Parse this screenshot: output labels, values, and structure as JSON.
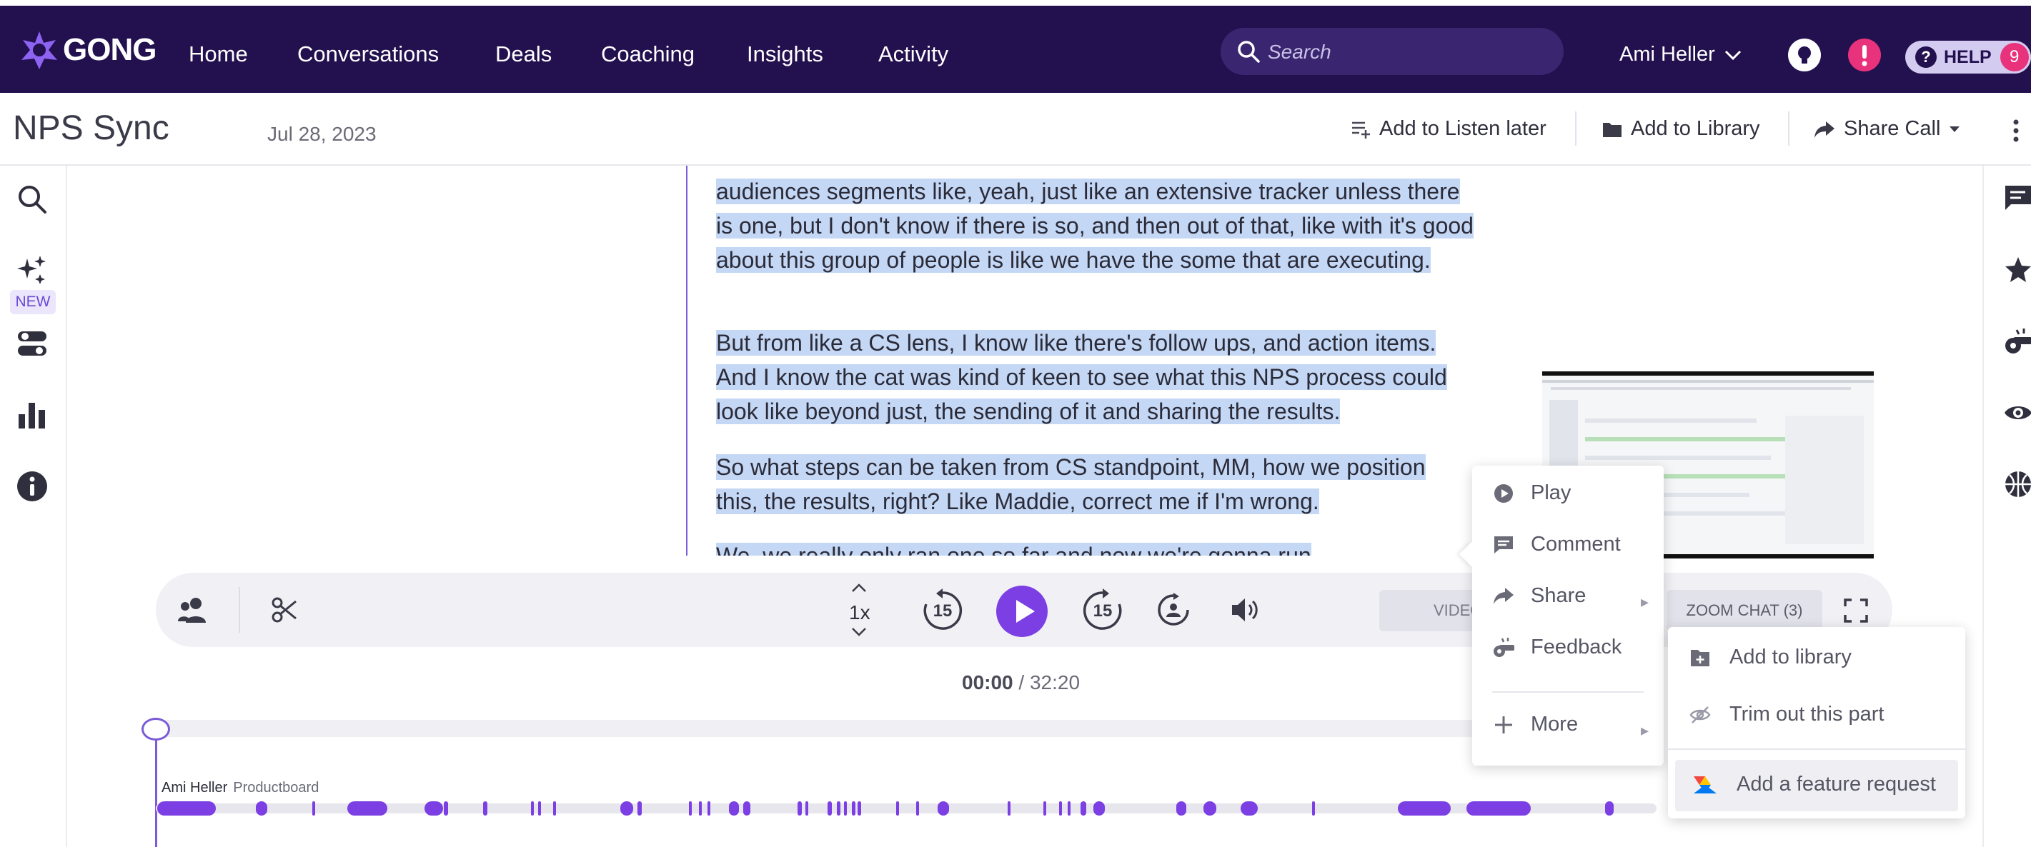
{
  "brand": {
    "logo_text": "GONG",
    "accent": "#7b3fe4",
    "nav_bg": "#23104f"
  },
  "nav": {
    "items": [
      "Home",
      "Conversations",
      "Deals",
      "Coaching",
      "Insights",
      "Activity"
    ],
    "search_placeholder": "Search",
    "user_name": "Ami Heller",
    "help_label": "HELP",
    "help_count": "9"
  },
  "call": {
    "title": "NPS Sync",
    "date": "Jul 28, 2023",
    "actions": {
      "listen_later": "Add to Listen later",
      "library": "Add to Library",
      "share": "Share Call"
    }
  },
  "left_rail": {
    "new_badge": "NEW"
  },
  "transcript": {
    "paragraphs": [
      "audiences segments like, yeah, just like an extensive tracker unless there is one, but I don't know if there is so, and then out of that, like with it's good about this group of people is like we have the some that are executing.",
      "But from like a CS lens, I know like there's follow ups, and action items. And I know the cat was kind of keen to see what this NPS process could look like beyond just, the sending of it and sharing the results.",
      "So what steps can be taken from CS standpoint, MM, how we position this, the results, right? Like Maddie, correct me if I'm wrong.",
      "We, we really only ran one so far and now we're gonna run"
    ]
  },
  "player": {
    "speed": "1x",
    "skip_back": "15",
    "skip_forward": "15",
    "video_tab": "VIDEO",
    "zoom_tab": "ZOOM CHAT (3)",
    "current_time": "00:00",
    "total_time": " / 32:20",
    "progress": 0.0
  },
  "timeline": {
    "speaker": "Ami Heller",
    "company": "Productboard"
  },
  "context_menu": {
    "items": [
      {
        "label": "Play",
        "icon": "play-circle-icon"
      },
      {
        "label": "Comment",
        "icon": "comment-icon"
      },
      {
        "label": "Share",
        "icon": "share-arrow-icon"
      },
      {
        "label": "Feedback",
        "icon": "whistle-icon"
      },
      {
        "label": "More",
        "icon": "plus-icon"
      }
    ]
  },
  "more_submenu": {
    "items": [
      {
        "label": "Add to library",
        "icon": "library-add-icon"
      },
      {
        "label": "Trim out this part",
        "icon": "eye-off-icon"
      },
      {
        "label": "Add a feature request",
        "icon": "productboard-icon"
      }
    ]
  }
}
